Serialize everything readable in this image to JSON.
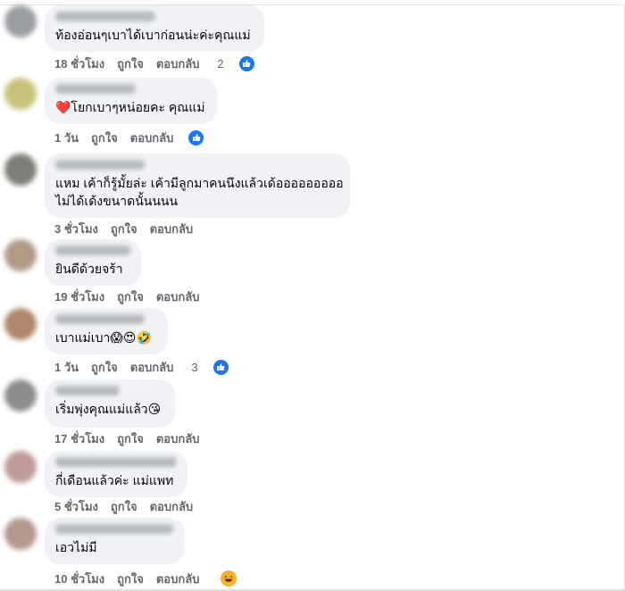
{
  "actions": {
    "like": "ถูกใจ",
    "reply": "ตอบกลับ"
  },
  "colors": {
    "bubble": "#f0f2f5",
    "action_text": "#65676b",
    "like_blue": "#1877f2"
  },
  "comments": [
    {
      "text": "ท้องอ่อนๆเบาได้เบาก่อนน่ะค่ะคุณแม่",
      "time": "18 ชั่วโมง",
      "reaction_count": "2",
      "reaction": "like-icon"
    },
    {
      "text": "❤️โยกเบาๆหน่อยคะ คุณแม่",
      "time": "1 วัน",
      "reaction_count": "",
      "reaction": "like-icon"
    },
    {
      "text_line1": "แหม เค้าก็รู้มั้ยล่ะ เค้ามีลูกมาคนนึงแล้วเด้อออออออออ",
      "text_line2": "ไม่ได้เด้งขนาดนั้นนนน",
      "time": "3 ชั่วโมง"
    },
    {
      "text": "ยินดีด้วยจร้า",
      "time": "19 ชั่วโมง"
    },
    {
      "text": "เบาแม่เบา😱😍🤣",
      "time": "1 วัน",
      "reaction_count": "3",
      "reaction": "like-icon"
    },
    {
      "text": "เริ่มพุ่งคุณแม่แล้ว😘",
      "time": "17 ชั่วโมง"
    },
    {
      "text": "กี่เดือนแล้วค่ะ แม่แพท",
      "time": "5 ชั่วโมง"
    },
    {
      "text": "เอวไม่มี",
      "time": "10 ชั่วโมง",
      "reaction": "haha-icon"
    }
  ]
}
